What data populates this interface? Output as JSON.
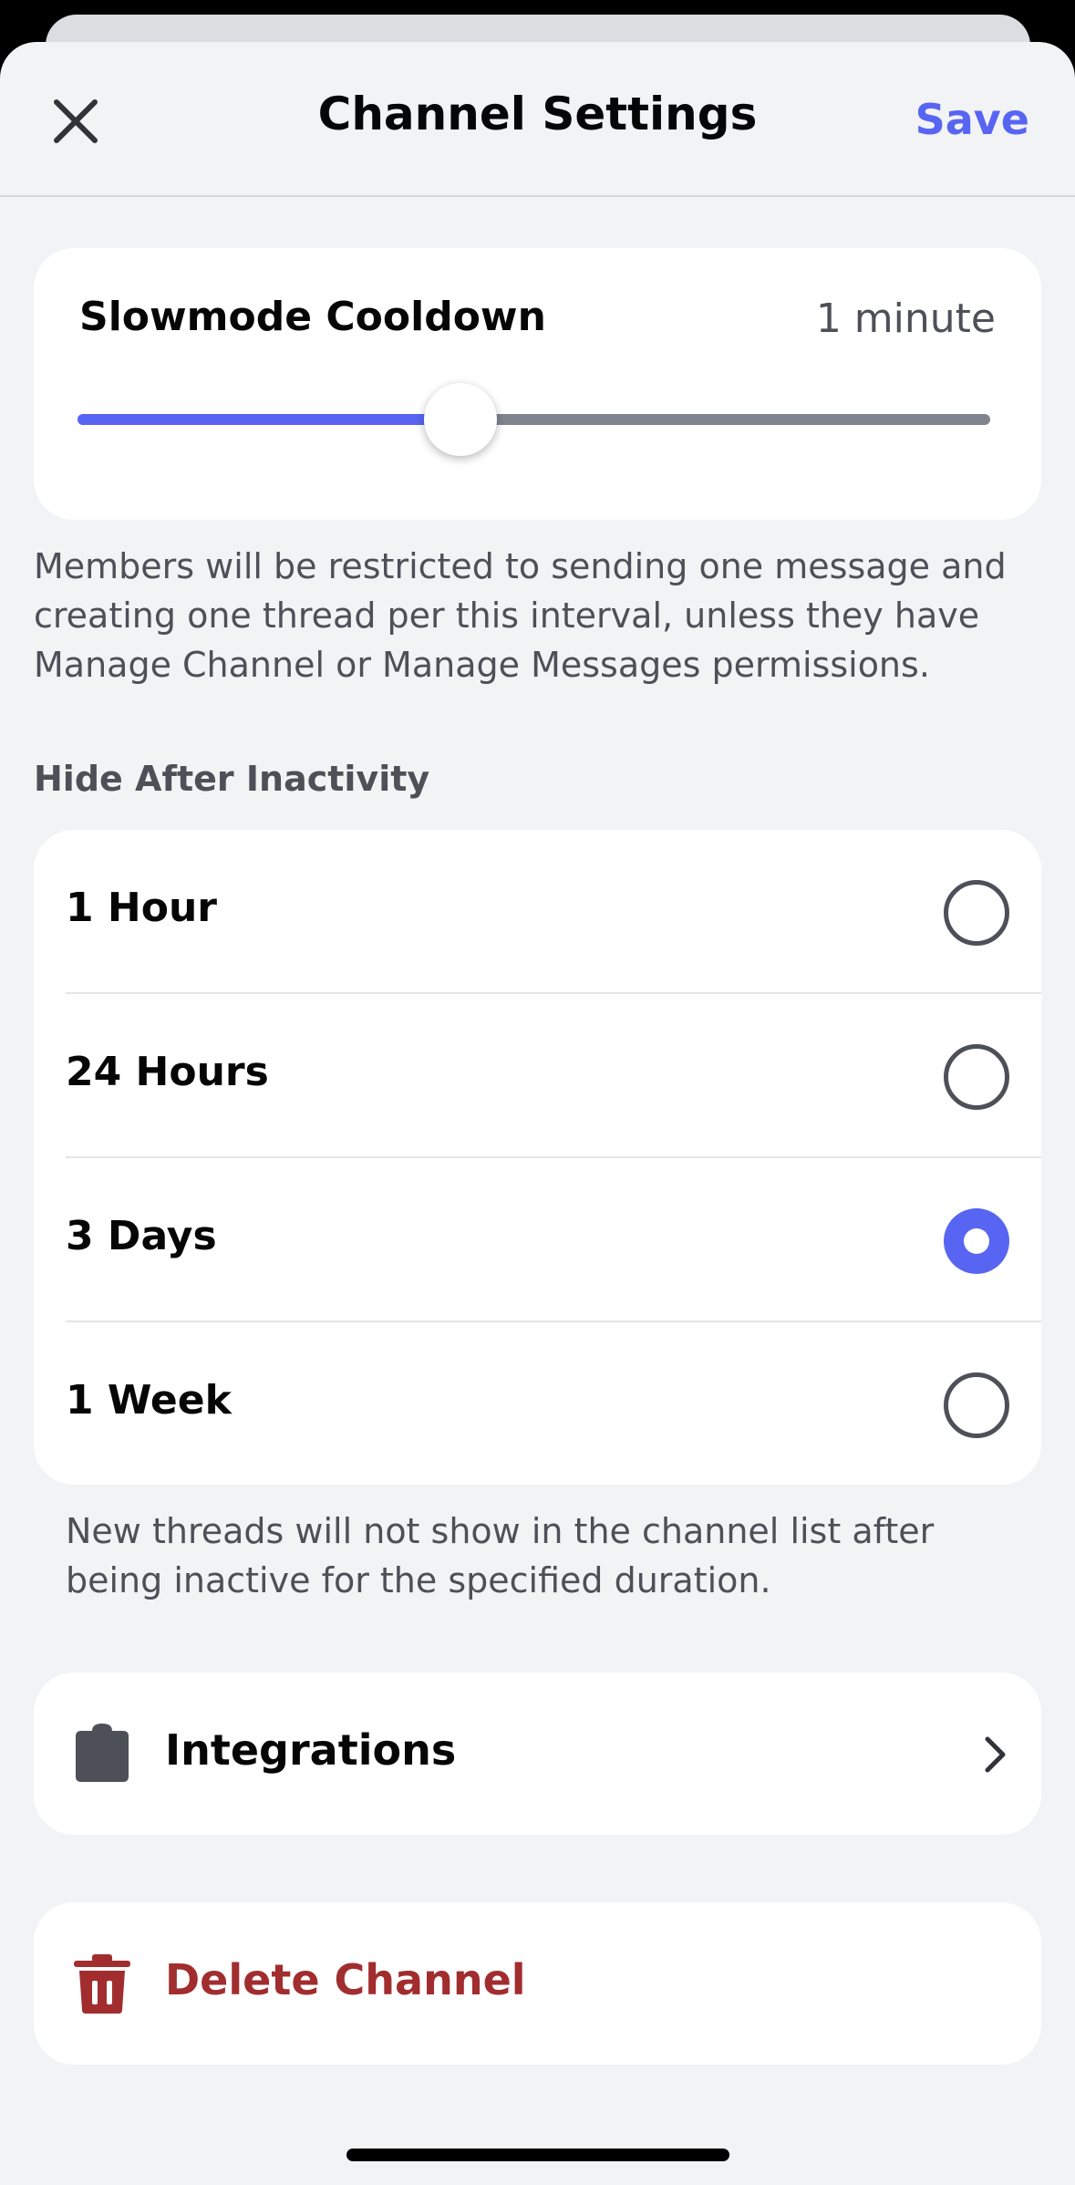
{
  "header": {
    "title": "Channel Settings",
    "save_label": "Save"
  },
  "slowmode": {
    "title": "Slowmode Cooldown",
    "value": "1 minute",
    "slider_fraction": 0.42,
    "description": "Members will be restricted to sending one message and creating one thread per this interval, unless they have Manage Channel or Manage Messages permissions."
  },
  "hide_after_inactivity": {
    "label": "Hide After Inactivity",
    "options": [
      {
        "label": "1 Hour",
        "selected": false
      },
      {
        "label": "24 Hours",
        "selected": false
      },
      {
        "label": "3 Days",
        "selected": true
      },
      {
        "label": "1 Week",
        "selected": false
      }
    ],
    "description": "New threads will not show in the channel list after being inactive for the specified duration."
  },
  "integrations": {
    "label": "Integrations",
    "icon": "puzzle-icon"
  },
  "delete": {
    "label": "Delete Channel",
    "icon": "trash-icon"
  },
  "colors": {
    "accent": "#5865f2",
    "danger": "#a12d2f",
    "background": "#f2f3f5"
  }
}
